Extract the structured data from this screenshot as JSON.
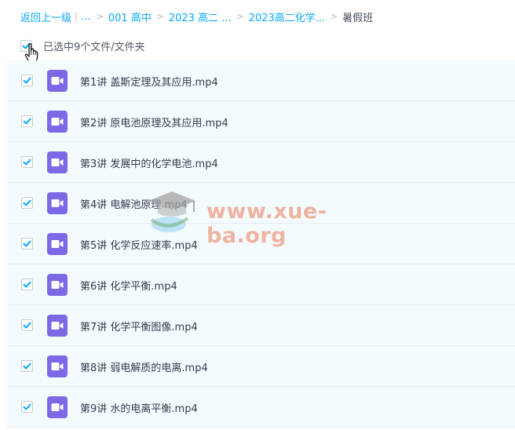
{
  "breadcrumb": {
    "back": "返回上一级",
    "ellipsis": "...",
    "crumb1": "001 高中",
    "crumb2": "2023 高二 ...",
    "crumb3": "2023高二化学...",
    "current": "暑假班"
  },
  "selection": {
    "label": "已选中9个文件/文件夹",
    "all_checked": true
  },
  "files": [
    {
      "name": "第1讲 盖斯定理及其应用.mp4",
      "checked": true
    },
    {
      "name": "第2讲 原电池原理及其应用.mp4",
      "checked": true
    },
    {
      "name": "第3讲 发展中的化学电池.mp4",
      "checked": true
    },
    {
      "name": "第4讲 电解池原理.mp4",
      "checked": true
    },
    {
      "name": "第5讲 化学反应速率.mp4",
      "checked": true
    },
    {
      "name": "第6讲 化学平衡.mp4",
      "checked": true
    },
    {
      "name": "第7讲 化学平衡图像.mp4",
      "checked": true
    },
    {
      "name": "第8讲 弱电解质的电离.mp4",
      "checked": true
    },
    {
      "name": "第9讲 水的电离平衡.mp4",
      "checked": true
    }
  ],
  "watermark": {
    "text": "www.xue-ba.org"
  },
  "colors": {
    "accent": "#06a7ff",
    "video_icon": "#7b69e6",
    "row_selected": "#f4fbff"
  },
  "icons": {
    "checkbox": "check-icon",
    "file": "video-file-icon",
    "cursor": "hand-cursor-icon",
    "chevron": "chevron-right-icon"
  }
}
